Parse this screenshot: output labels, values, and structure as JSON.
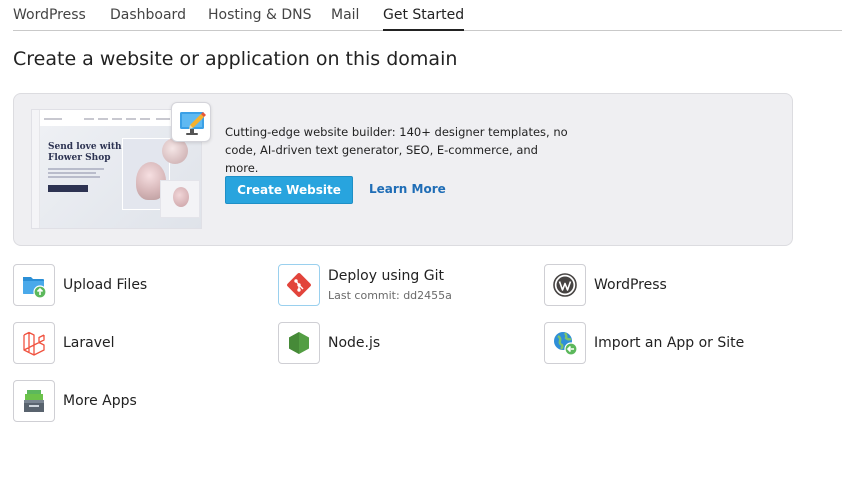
{
  "tabs": [
    {
      "label": "WordPress"
    },
    {
      "label": "Dashboard"
    },
    {
      "label": "Hosting & DNS"
    },
    {
      "label": "Mail"
    },
    {
      "label": "Get Started"
    }
  ],
  "page_title": "Create a website or application on this domain",
  "promo": {
    "preview": {
      "headline_line1": "Send love with",
      "headline_line2": "Flower Shop"
    },
    "description": "Cutting-edge website builder: 140+ designer templates, no code, AI-driven text generator, SEO, E-commerce, and more.",
    "create_button": "Create Website",
    "learn_more": "Learn More"
  },
  "apps": {
    "upload": {
      "label": "Upload Files",
      "icon": "upload-folder-icon"
    },
    "git": {
      "label": "Deploy using Git",
      "sub": "Last commit: dd2455a",
      "icon": "git-icon"
    },
    "wordpress": {
      "label": "WordPress",
      "icon": "wordpress-icon"
    },
    "laravel": {
      "label": "Laravel",
      "icon": "laravel-icon"
    },
    "nodejs": {
      "label": "Node.js",
      "icon": "nodejs-icon"
    },
    "import": {
      "label": "Import an App or Site",
      "icon": "import-globe-icon"
    },
    "more": {
      "label": "More Apps",
      "icon": "app-catalog-icon"
    }
  },
  "colors": {
    "accent_button": "#28a4de",
    "link": "#1f6db6",
    "promo_bg": "#efeff2",
    "git_red": "#e2443b",
    "laravel_red": "#f05340",
    "node_green": "#539e43",
    "wordpress_gray": "#464342"
  }
}
